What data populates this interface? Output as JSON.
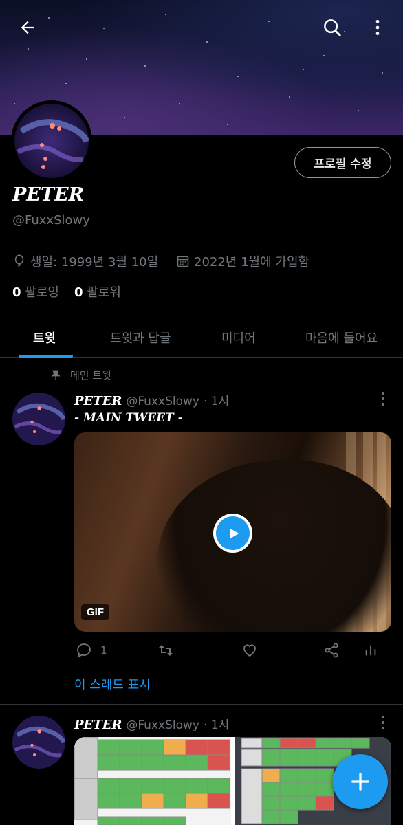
{
  "header": {
    "back_icon": "arrow-left-icon",
    "search_icon": "search-icon",
    "more_icon": "more-vertical-icon"
  },
  "profile": {
    "edit_button": "프로필 수정",
    "name": "PETER",
    "handle": "@FuxxSlowy",
    "birthday": "생일: 1999년 3월 10일",
    "joined": "2022년 1월에 가입함",
    "following_count": "0",
    "following_label": "팔로잉",
    "followers_count": "0",
    "followers_label": "팔로워"
  },
  "tabs": [
    {
      "label": "트윗",
      "active": true
    },
    {
      "label": "트윗과 답글",
      "active": false
    },
    {
      "label": "미디어",
      "active": false
    },
    {
      "label": "마음에 들어요",
      "active": false
    }
  ],
  "pinned_label": "메인 트윗",
  "tweets": [
    {
      "name": "PETER",
      "handle": "@FuxxSlowy",
      "time": "· 1시",
      "text": "- MAIN TWEET -",
      "media_badge": "GIF",
      "reply_count": "1",
      "thread_link": "이 스레드 표시"
    },
    {
      "name": "PETER",
      "handle": "@FuxxSlowy",
      "time": "· 1시"
    }
  ],
  "colors": {
    "accent": "#1d9bf0",
    "background": "#000000",
    "muted": "#71767b"
  }
}
